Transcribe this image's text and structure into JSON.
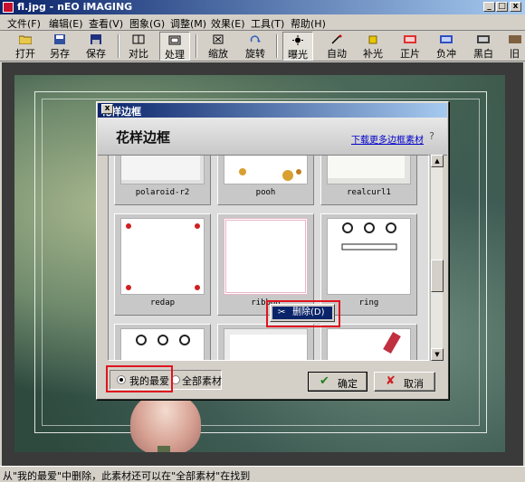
{
  "window": {
    "title": "fl.jpg - nEO iMAGING",
    "min_label": "_",
    "max_label": "□",
    "close_label": "x"
  },
  "menu": [
    "文件(F)",
    "编辑(E)",
    "查看(V)",
    "图象(G)",
    "调整(M)",
    "效果(E)",
    "工具(T)",
    "帮助(H)"
  ],
  "toolbar": [
    "打开",
    "另存",
    "保存",
    "对比",
    "处理",
    "缩放",
    "旋转",
    "曝光",
    "自动",
    "补光",
    "正片",
    "负冲",
    "黑白",
    "旧"
  ],
  "dialog": {
    "title": "花样边框",
    "close_label": "x",
    "heading": "花样边框",
    "download_link": "下载更多边框素材",
    "help_label": "?",
    "frames": [
      "polaroid-r2",
      "pooh",
      "realcurl1",
      "redap",
      "ribbon",
      "ring"
    ],
    "context_menu_item": "删除(D)",
    "radio_favorites": "我的最爱",
    "radio_all": "全部素材",
    "ok_label": "确定",
    "cancel_label": "取消"
  },
  "status": "从\"我的最爱\"中删除，此素材还可以在\"全部素材\"在找到",
  "colors": {
    "titlebar": "#0a246a",
    "highlight": "#e0141e",
    "face": "#d4d0c8"
  }
}
